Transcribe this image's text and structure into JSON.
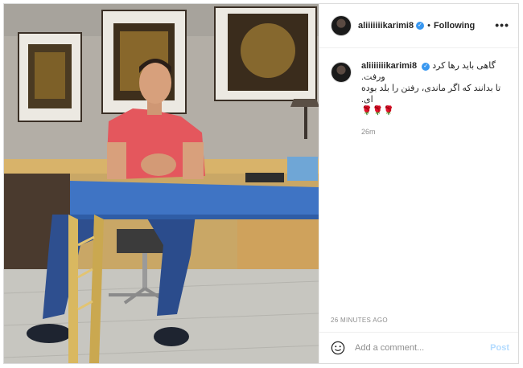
{
  "post": {
    "username": "aliiiiiiikarimi8",
    "verified_mark": "✓",
    "separator": "•",
    "follow_status": "Following",
    "more_menu": "•••",
    "caption_lines": [
      "گاهی باید رها کرد",
      "ورفت.",
      "تا بدانند که اگر ماندی، رفتن را بلد بوده ای.",
      "🌹🌹🌹"
    ],
    "relative_time": "26m",
    "timestamp": "26 MINUTES AGO"
  },
  "comment_bar": {
    "emoji_icon": "smiley-icon",
    "placeholder": "Add a comment...",
    "post_label": "Post"
  },
  "colors": {
    "verified_blue": "#3897f0",
    "muted_text": "#8e8e8e",
    "post_disabled": "#b3dbff",
    "shirt_red": "#e4575d",
    "desk_blue": "#3f74c4"
  }
}
